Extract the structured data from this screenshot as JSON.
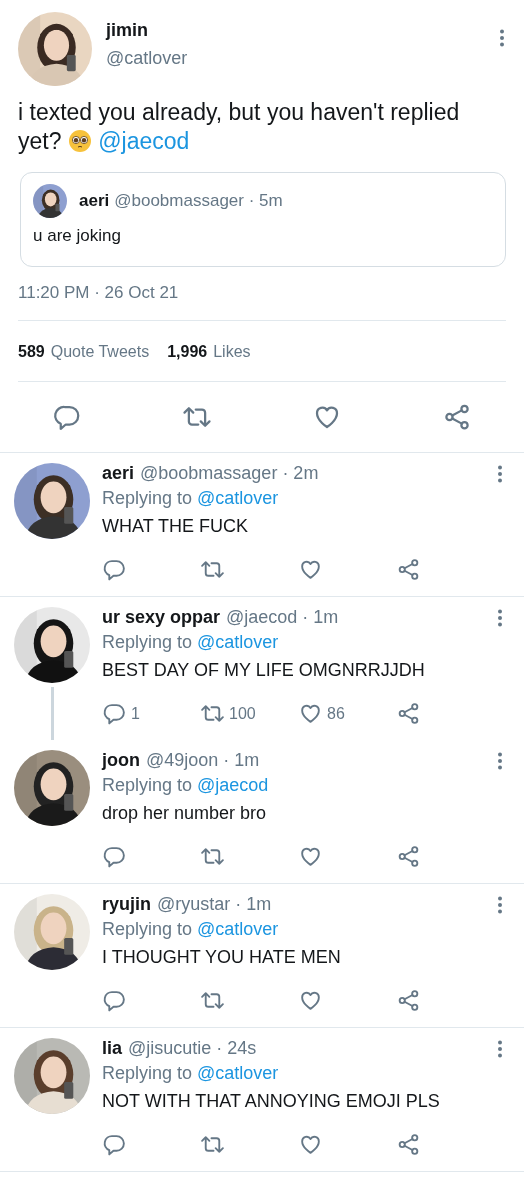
{
  "tweet": {
    "author": {
      "name": "jimin",
      "handle": "@catlover"
    },
    "text": "i texted you already, but you haven't replied yet?",
    "mention": "@jaecod",
    "quote": {
      "name": "aeri",
      "handle": "@boobmassager",
      "time": "· 5m",
      "text": "u are joking"
    },
    "timestamp": "11:20 PM · 26 Oct 21",
    "stats": [
      {
        "count": "589",
        "label": "Quote Tweets"
      },
      {
        "count": "1,996",
        "label": "Likes"
      }
    ]
  },
  "replies": [
    {
      "name": "aeri",
      "handle": "@boobmassager",
      "time": "· 2m",
      "replying_label": "Replying to",
      "replying_to": "@catlover",
      "text": "WHAT THE FUCK",
      "thread_continues": false
    },
    {
      "name": "ur sexy oppar",
      "handle": "@jaecod",
      "time": "· 1m",
      "replying_label": "Replying to",
      "replying_to": "@catlover",
      "text": "BEST DAY OF MY LIFE OMGNRRJJDH",
      "reply_count": "1",
      "retweet_count": "100",
      "like_count": "86",
      "thread_continues": true
    },
    {
      "name": "joon",
      "handle": "@49joon",
      "time": "· 1m",
      "replying_label": "Replying to",
      "replying_to": "@jaecod",
      "text": "drop her number bro",
      "thread_continues": false
    },
    {
      "name": "ryujin",
      "handle": "@ryustar",
      "time": "· 1m",
      "replying_label": "Replying to",
      "replying_to": "@catlover",
      "text": "I THOUGHT YOU HATE MEN",
      "thread_continues": false
    },
    {
      "name": "lia",
      "handle": "@jisucutie",
      "time": "· 24s",
      "replying_label": "Replying to",
      "replying_to": "@catlover",
      "text": "NOT WITH THAT ANNOYING EMOJI PLS",
      "thread_continues": false
    }
  ]
}
